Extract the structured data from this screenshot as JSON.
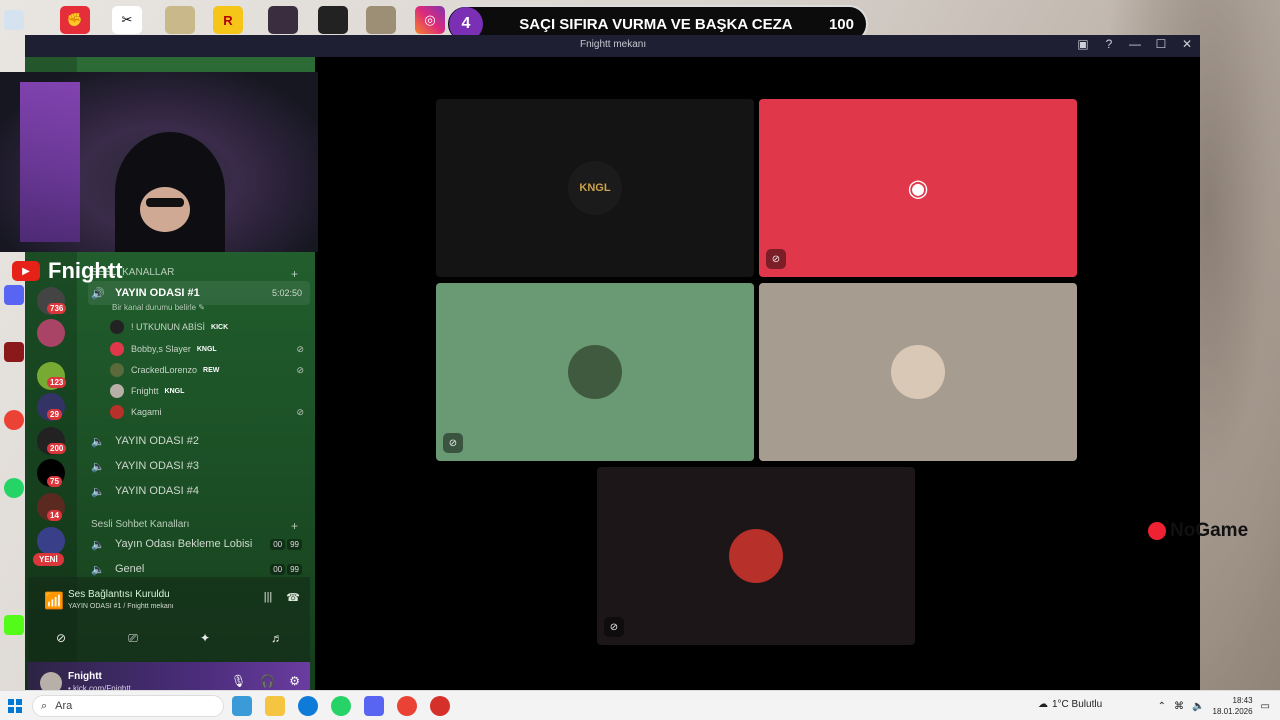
{
  "banner": {
    "round": "4",
    "text": "SAÇI SIFIRA VURMA VE BAŞKA CEZA",
    "score": "100"
  },
  "window": {
    "title": "Fnightt mekanı"
  },
  "streamer": {
    "name": "Fnightt"
  },
  "sidebar": {
    "voice_category": "SESLİ KANALLAR",
    "active_channel": {
      "name": "YAYIN ODASI #1",
      "timer": "5:02:50",
      "status": "Bir kanal durumu belirle"
    },
    "members": [
      {
        "name": "! UTKUNUN ABİSİ",
        "tag": "KICK",
        "muted": false
      },
      {
        "name": "Bobby,s Slayer",
        "tag": "KNGL",
        "muted": true
      },
      {
        "name": "CrackedLorenzo",
        "tag": "REW",
        "muted": true
      },
      {
        "name": "Fnightt",
        "tag": "KNGL",
        "muted": false
      },
      {
        "name": "Kagami",
        "tag": "",
        "muted": true
      }
    ],
    "channels": [
      "YAYIN ODASI #2",
      "YAYIN ODASI #3",
      "YAYIN ODASI #4"
    ],
    "chat_category": "Sesli Sohbet Kanalları",
    "chat_channels": [
      {
        "name": "Yayın Odası Bekleme Lobisi",
        "count_a": "00",
        "count_b": "99"
      },
      {
        "name": "Genel",
        "count_a": "00",
        "count_b": "99"
      }
    ],
    "server_badges": [
      "736",
      "123",
      "29",
      "200",
      "75",
      "14"
    ],
    "new_badge": "YENİ"
  },
  "voice_panel": {
    "title": "Ses Bağlantısı Kuruldu",
    "subtitle": "YAYIN ODASI #1 / Fnightt mekanı"
  },
  "user_panel": {
    "name": "Fnightt",
    "subtitle": "• kick.com/Fnightt"
  },
  "tiles": [
    {
      "label": "KNGL",
      "bg": "#141414",
      "avatar": "#1b1b1b"
    },
    {
      "label": "discord",
      "bg": "#e0384a",
      "avatar": "#e0384a"
    },
    {
      "label": "",
      "bg": "#6a9a73",
      "avatar": "#3f5a3f"
    },
    {
      "label": "",
      "bg": "#a69c8f",
      "avatar": "#d9c8b6"
    },
    {
      "label": "",
      "bg": "#1d1618",
      "avatar": "#b8302a"
    }
  ],
  "brand_right": "NoGame",
  "taskbar": {
    "search": "Ara",
    "weather": "1°C  Bulutlu",
    "time": "18:43",
    "date": "18.01.2026"
  }
}
